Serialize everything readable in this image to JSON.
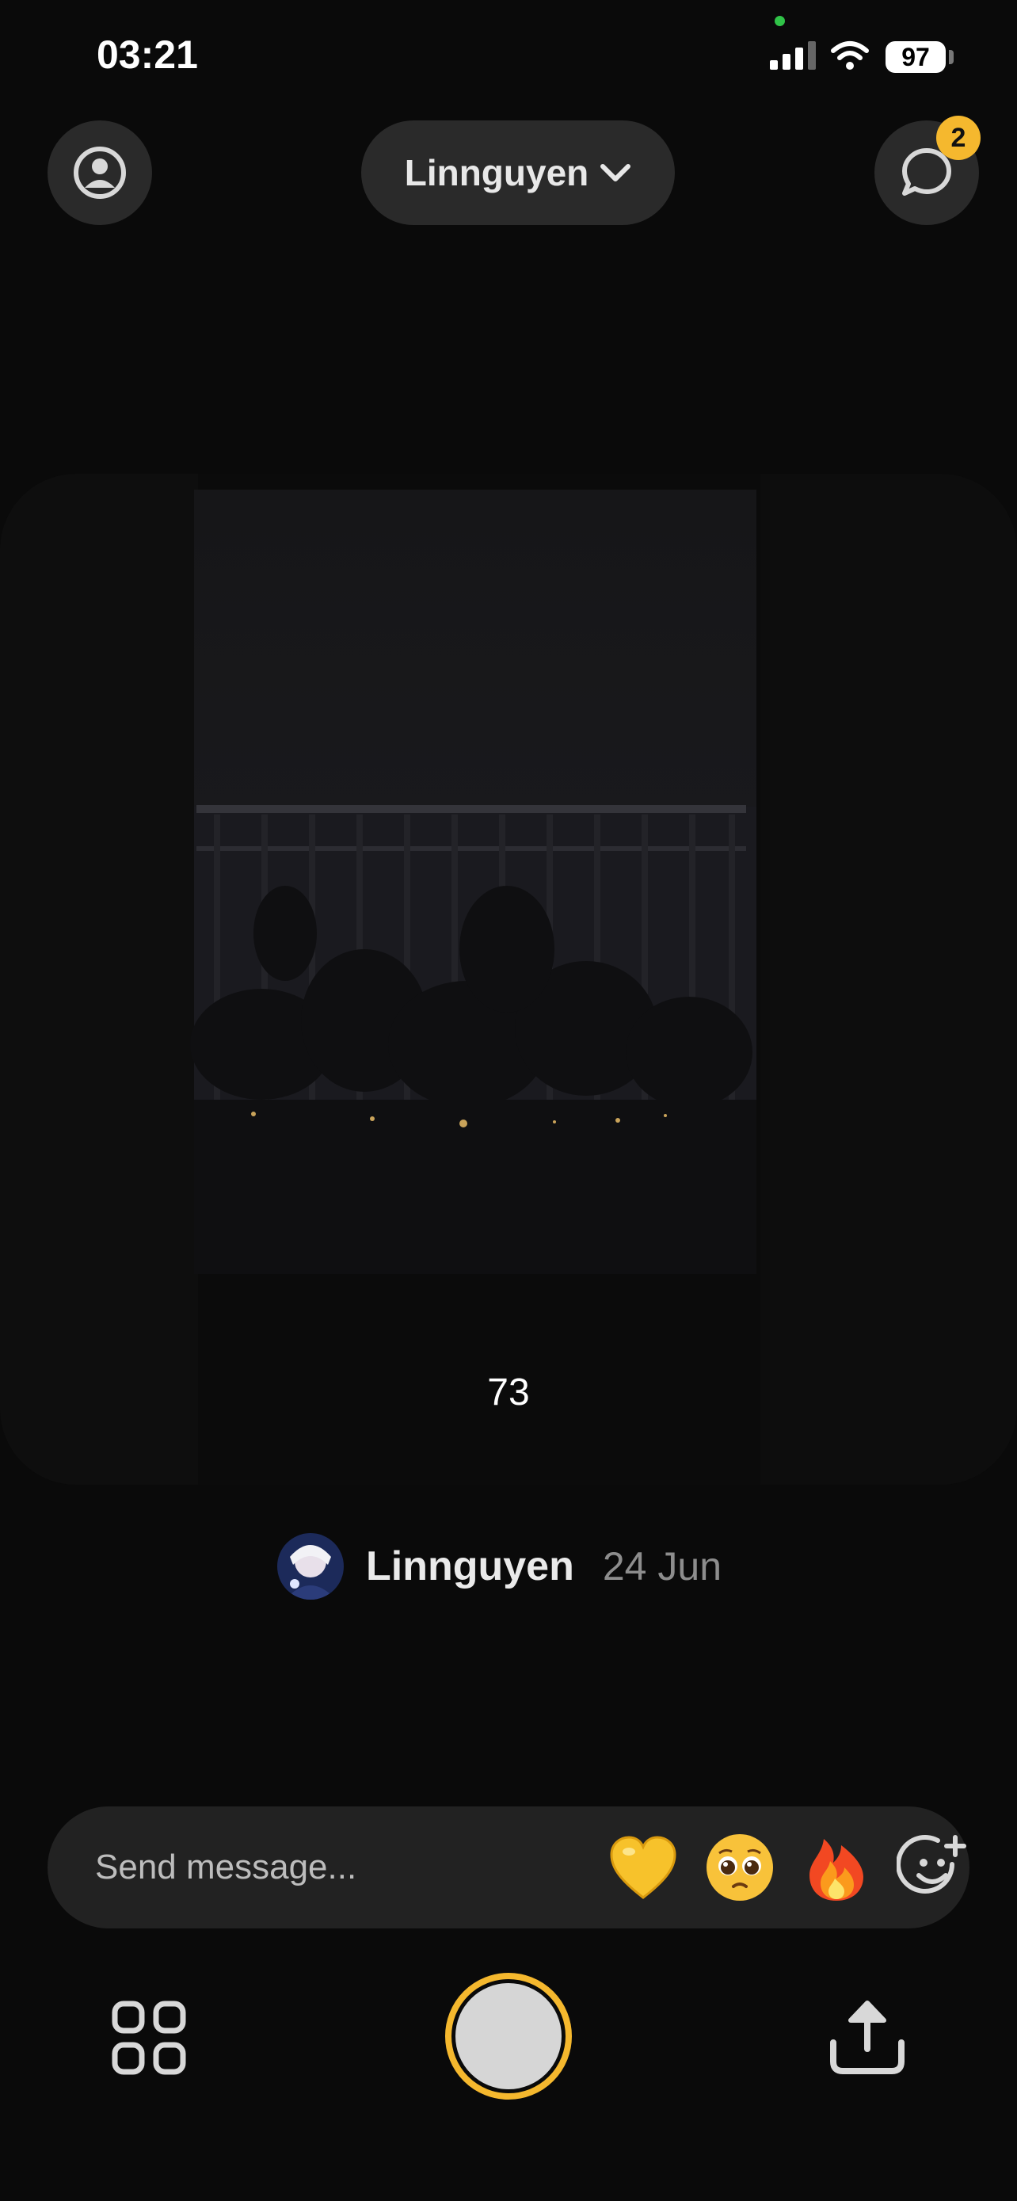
{
  "status_bar": {
    "time": "03:21",
    "battery": "97"
  },
  "header": {
    "friend_selector": "Linnguyen",
    "chat_badge_count": "2"
  },
  "photo": {
    "reaction_count": "73"
  },
  "author": {
    "name": "Linnguyen",
    "date": "24 Jun"
  },
  "message": {
    "placeholder": "Send message..."
  },
  "colors": {
    "accent": "#f5b82e",
    "background": "#0a0a0a",
    "surface": "#2a2a2a"
  },
  "icons": [
    "profile-icon",
    "chevron-down-icon",
    "chat-bubble-icon",
    "yellow-heart-emoji",
    "pleading-face-emoji",
    "fire-emoji",
    "add-emoji-icon",
    "grid-icon",
    "share-icon"
  ]
}
